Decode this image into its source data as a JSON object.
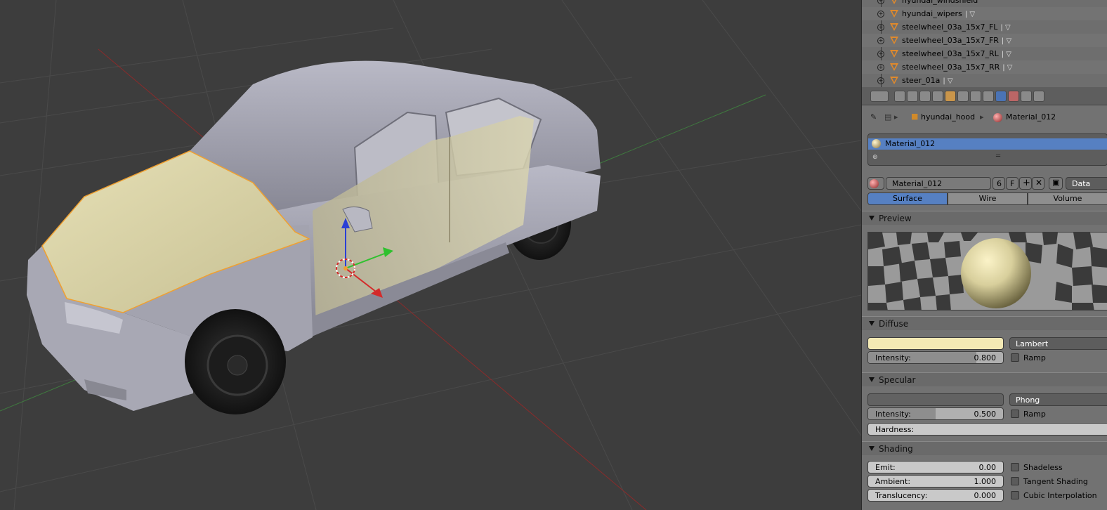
{
  "outliner": {
    "items": [
      {
        "name": "hyundai_windshield"
      },
      {
        "name": "hyundai_wipers"
      },
      {
        "name": "steelwheel_03a_15x7_FL"
      },
      {
        "name": "steelwheel_03a_15x7_FR"
      },
      {
        "name": "steelwheel_03a_15x7_RL"
      },
      {
        "name": "steelwheel_03a_15x7_RR"
      },
      {
        "name": "steer_01a"
      }
    ]
  },
  "properties": {
    "breadcrumb": {
      "object": "hyundai_hood",
      "material": "Material_012"
    },
    "material_slots": [
      {
        "name": "Material_012",
        "selected": true
      }
    ],
    "datablock": {
      "name": "Material_012",
      "users": "6",
      "fake_user": "F",
      "link": "Data"
    },
    "tabs": {
      "surface": "Surface",
      "wire": "Wire",
      "volume": "Volume",
      "active": "surface"
    },
    "preview": {
      "title": "Preview"
    },
    "diffuse": {
      "title": "Diffuse",
      "color": "#f3e9b4",
      "shader": "Lambert",
      "intensity_label": "Intensity:",
      "intensity": "0.800",
      "ramp": "Ramp"
    },
    "specular": {
      "title": "Specular",
      "color": "#626262",
      "shader": "Phong",
      "intensity_label": "Intensity:",
      "intensity": "0.500",
      "ramp": "Ramp",
      "hardness_label": "Hardness:"
    },
    "shading": {
      "title": "Shading",
      "emit_label": "Emit:",
      "emit": "0.00",
      "ambient_label": "Ambient:",
      "ambient": "1.000",
      "translucency_label": "Translucency:",
      "translucency": "0.000",
      "shadeless": "Shadeless",
      "tangent": "Tangent Shading",
      "cubic": "Cubic Interpolation"
    }
  },
  "colors": {
    "accent": "#5680c2",
    "car_body": "#9a9aa6",
    "hood_selected": "#d8d2a6",
    "outline": "#f0a030"
  }
}
